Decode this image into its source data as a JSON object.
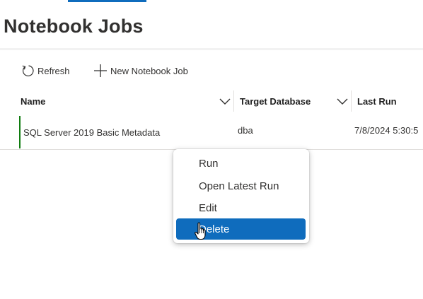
{
  "page": {
    "title": "Notebook Jobs"
  },
  "toolbar": {
    "refresh_label": "Refresh",
    "refresh_icon": "refresh-icon",
    "new_job_label": "New Notebook Job",
    "new_job_icon": "plus-icon"
  },
  "table": {
    "columns": [
      {
        "label": "Name"
      },
      {
        "label": "Target Database"
      },
      {
        "label": "Last Run"
      }
    ],
    "rows": [
      {
        "name": "SQL Server 2019 Basic Metadata",
        "target_database": "dba",
        "last_run": "7/8/2024 5:30:5"
      }
    ]
  },
  "context_menu": {
    "items": [
      {
        "label": "Run"
      },
      {
        "label": "Open Latest Run"
      },
      {
        "label": "Edit"
      },
      {
        "label": "Delete",
        "highlighted": true
      }
    ]
  },
  "colors": {
    "accent": "#0f6cbd",
    "row_status": "#107c10",
    "text": "#323130"
  }
}
